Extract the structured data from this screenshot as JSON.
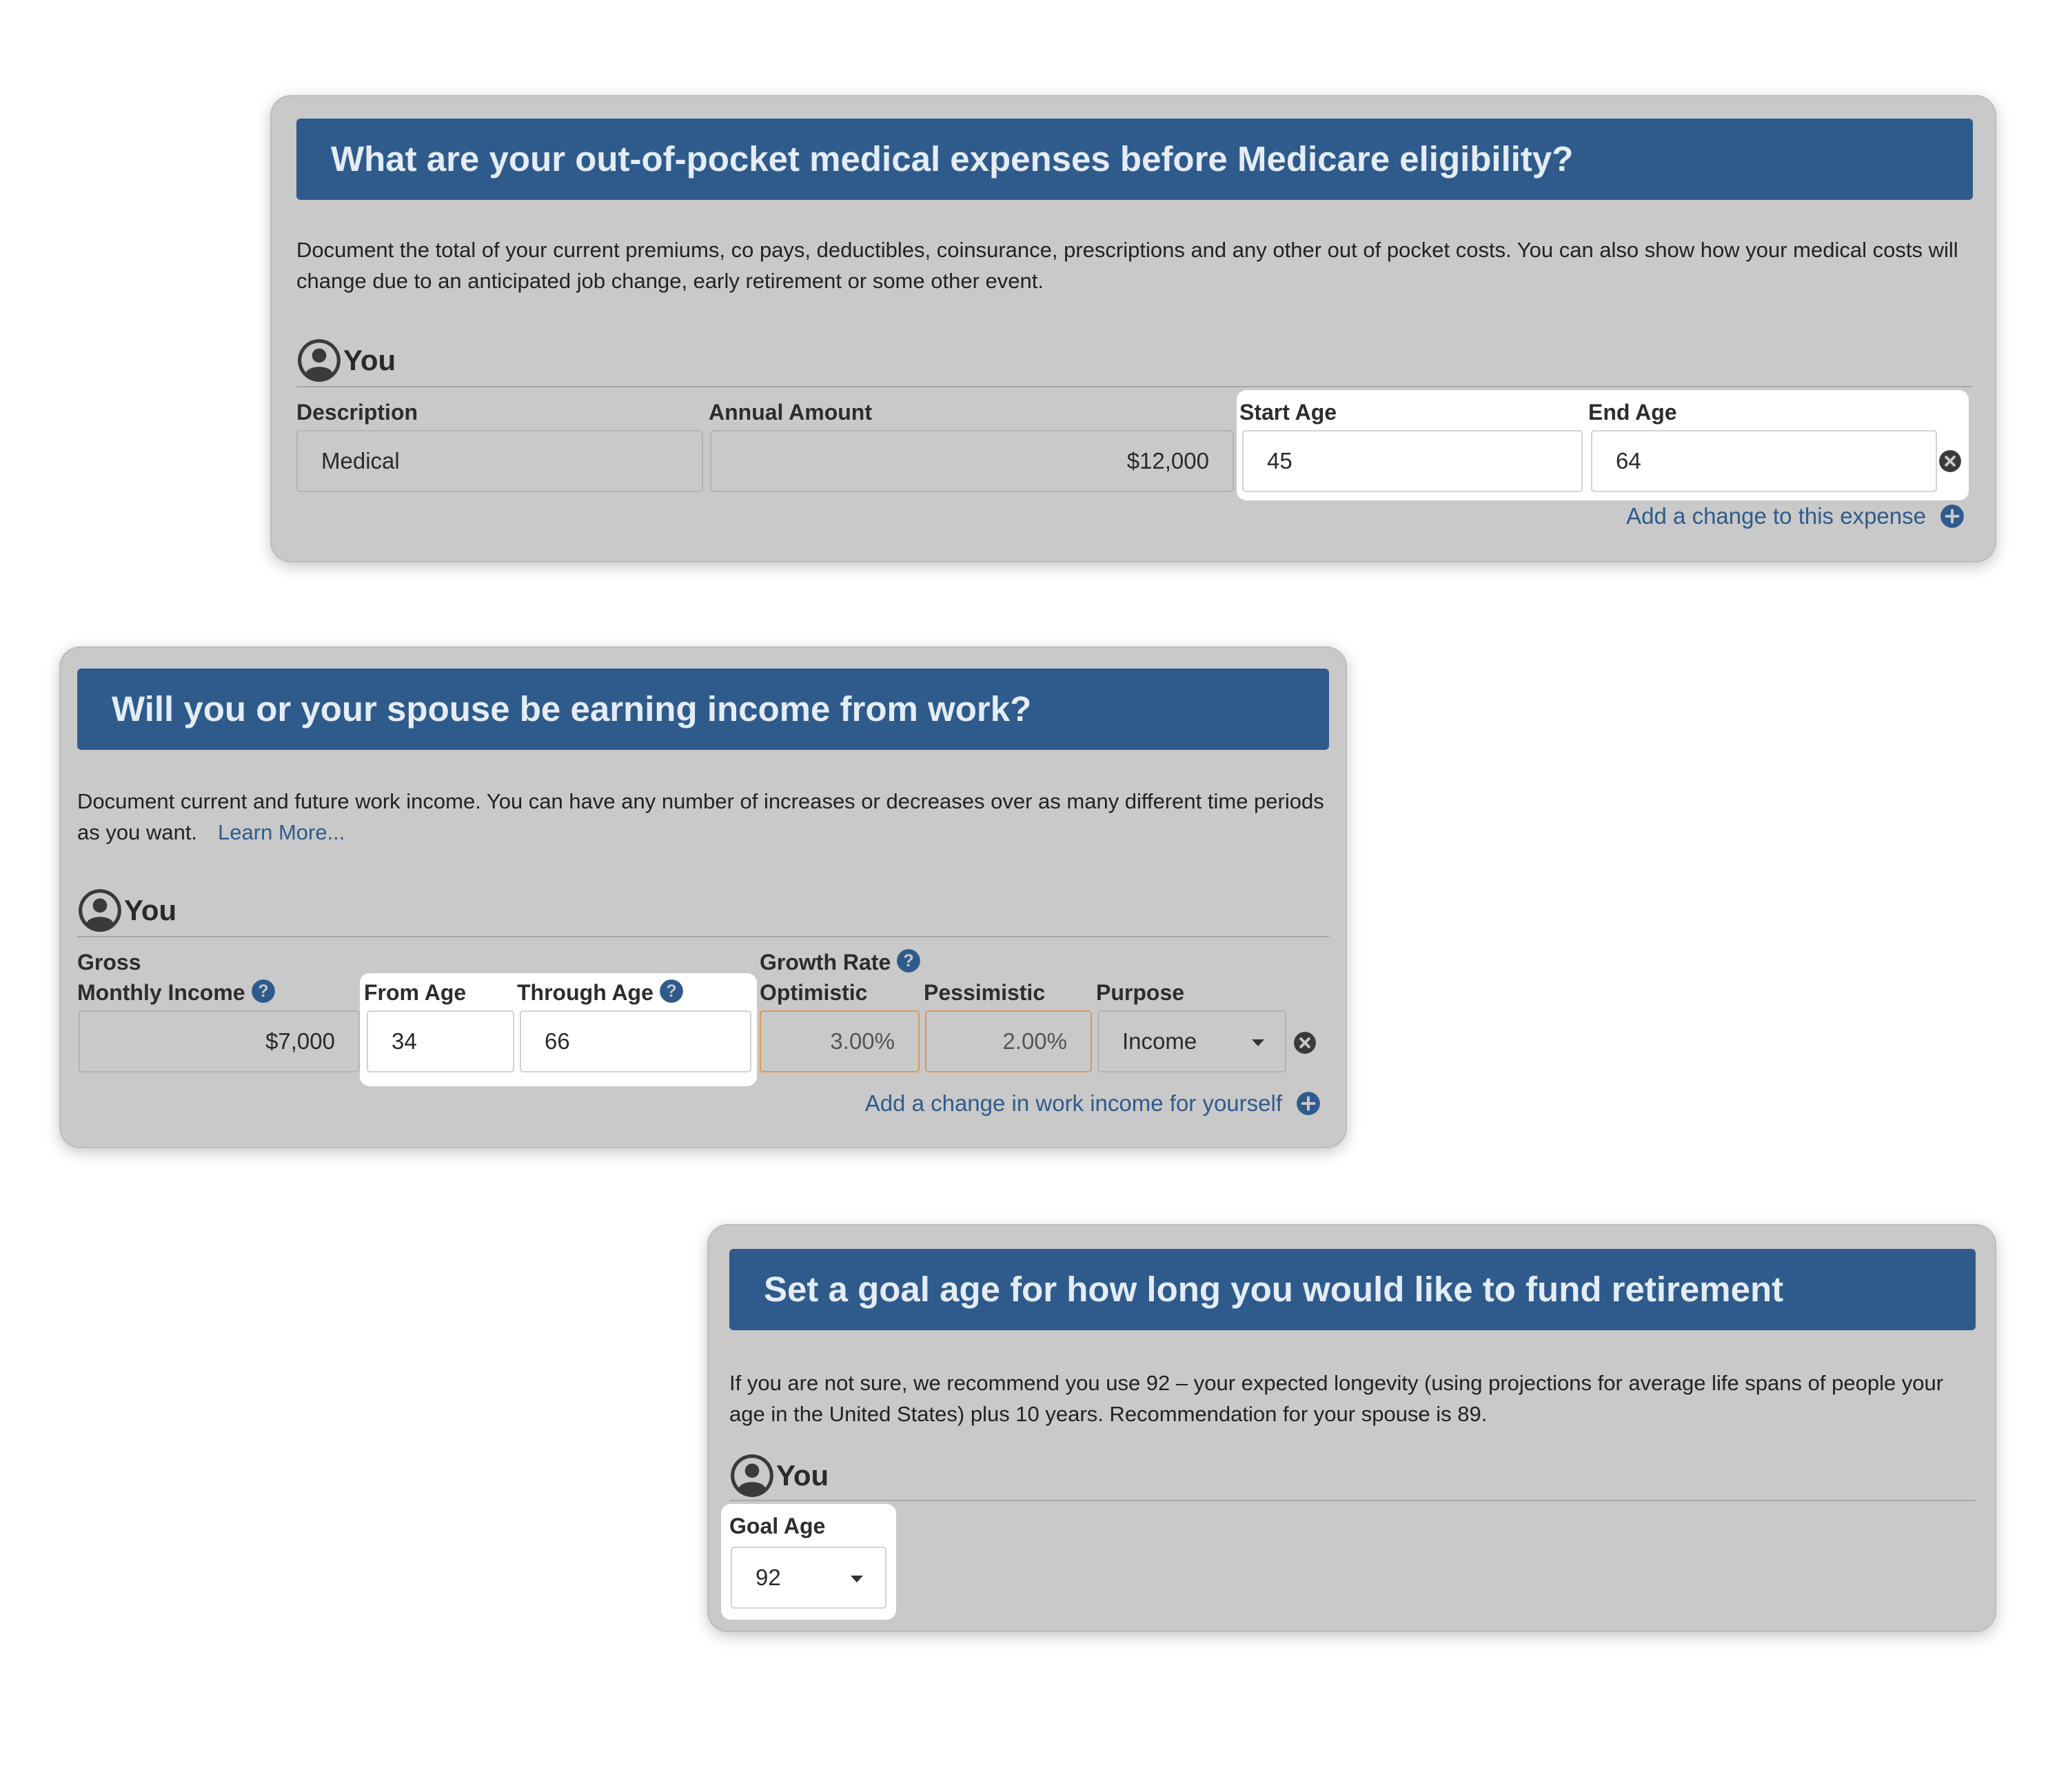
{
  "medical": {
    "title": "What are your out-of-pocket medical expenses before Medicare eligibility?",
    "description": "Document the total of your current premiums, co pays, deductibles, coinsurance, prescriptions and any other out of pocket costs. You can also show how your medical costs will change due to an anticipated job change, early retirement or some other event.",
    "person": "You",
    "columns": {
      "description": "Description",
      "annual_amount": "Annual Amount",
      "start_age": "Start Age",
      "end_age": "End Age"
    },
    "row": {
      "description": "Medical",
      "annual_amount": "$12,000",
      "start_age": "45",
      "end_age": "64"
    },
    "add_change": "Add a change to this expense"
  },
  "income": {
    "title": "Will you or your spouse be earning income from work?",
    "description": "Document current and future work income. You can have any number of increases or decreases over as many different time periods as you want.",
    "learn_more": "Learn More...",
    "person": "You",
    "columns": {
      "gross_line1": "Gross",
      "gross_line2": "Monthly Income",
      "from_age": "From Age",
      "through_age": "Through Age",
      "growth_rate": "Growth Rate",
      "optimistic": "Optimistic",
      "pessimistic": "Pessimistic",
      "purpose": "Purpose"
    },
    "row": {
      "monthly_income": "$7,000",
      "from_age": "34",
      "through_age": "66",
      "optimistic": "3.00%",
      "pessimistic": "2.00%",
      "purpose": "Income"
    },
    "add_change": "Add a change in work income for yourself"
  },
  "goal": {
    "title": "Set a goal age for how long you would like to fund retirement",
    "description": "If you are not sure, we recommend you use 92 – your expected longevity (using projections for average life spans of people your age in the United States) plus 10 years. Recommendation for your spouse is 89.",
    "person": "You",
    "goal_age_label": "Goal Age",
    "goal_age_value": "92"
  },
  "colors": {
    "header_bg": "#2f5b8c",
    "card_bg": "#c9c9c9",
    "link": "#2f5b8c",
    "highlight": "#ffffff",
    "orange_border": "#d89a55"
  }
}
